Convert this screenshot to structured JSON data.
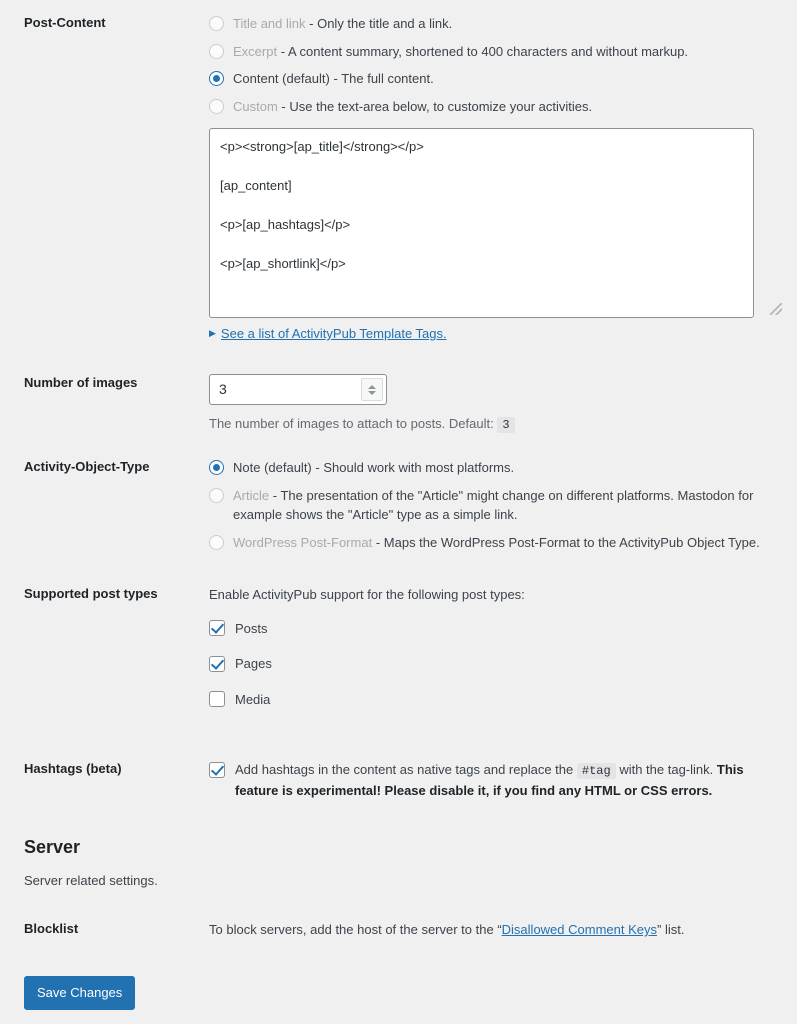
{
  "post_content": {
    "label": "Post-Content",
    "options": [
      {
        "id": "title-and-link",
        "name": "Title and link",
        "separator": "-",
        "desc": "Only the title and a link.",
        "checked": false,
        "dim": true
      },
      {
        "id": "excerpt",
        "name": "Excerpt",
        "separator": "-",
        "desc": "A content summary, shortened to 400 characters and without markup.",
        "checked": false,
        "dim": true
      },
      {
        "id": "content-default",
        "name": "Content (default)",
        "separator": "-",
        "desc": "The full content.",
        "checked": true,
        "dim": false
      },
      {
        "id": "custom",
        "name": "Custom",
        "separator": "-",
        "desc": "Use the text-area below, to customize your activities.",
        "checked": false,
        "dim": true
      }
    ],
    "textarea_value": "<p><strong>[ap_title]</strong></p>\n\n[ap_content]\n\n<p>[ap_hashtags]</p>\n\n<p>[ap_shortlink]</p>",
    "template_tags_marker": "▶",
    "template_tags_link": "See a list of ActivityPub Template Tags."
  },
  "number_of_images": {
    "label": "Number of images",
    "value": "3",
    "hint_prefix": "The number of images to attach to posts. Default:",
    "hint_default": "3"
  },
  "activity_object_type": {
    "label": "Activity-Object-Type",
    "options": [
      {
        "id": "note-default",
        "name": "Note (default)",
        "separator": "-",
        "desc": "Should work with most platforms.",
        "checked": true,
        "dim": false
      },
      {
        "id": "article",
        "name": "Article",
        "separator": "-",
        "desc": "The presentation of the \"Article\" might change on different platforms. Mastodon for example shows the \"Article\" type as a simple link.",
        "checked": false,
        "dim": true
      },
      {
        "id": "wordpress-post-format",
        "name": "WordPress Post-Format",
        "separator": "-",
        "desc": "Maps the WordPress Post-Format to the ActivityPub Object Type.",
        "checked": false,
        "dim": true
      }
    ]
  },
  "supported_post_types": {
    "label": "Supported post types",
    "intro": "Enable ActivityPub support for the following post types:",
    "items": [
      {
        "id": "posts",
        "label": "Posts",
        "checked": true
      },
      {
        "id": "pages",
        "label": "Pages",
        "checked": true
      },
      {
        "id": "media",
        "label": "Media",
        "checked": false
      }
    ]
  },
  "hashtags": {
    "label": "Hashtags (beta)",
    "checked": true,
    "text_before": "Add hashtags in the content as native tags and replace the",
    "code": "#tag",
    "text_middle": "with the tag-link.",
    "text_bold": "This feature is experimental! Please disable it, if you find any HTML or CSS errors."
  },
  "server": {
    "heading": "Server",
    "subtitle": "Server related settings."
  },
  "blocklist": {
    "label": "Blocklist",
    "text_before": "To block servers, add the host of the server to the “",
    "link": "Disallowed Comment Keys",
    "text_after": "” list."
  },
  "actions": {
    "save_label": "Save Changes"
  },
  "colors": {
    "accent": "#2271b1",
    "background": "#f0f0f1",
    "text": "#3c434a",
    "heading": "#1d2327",
    "muted": "#a7aaad"
  }
}
